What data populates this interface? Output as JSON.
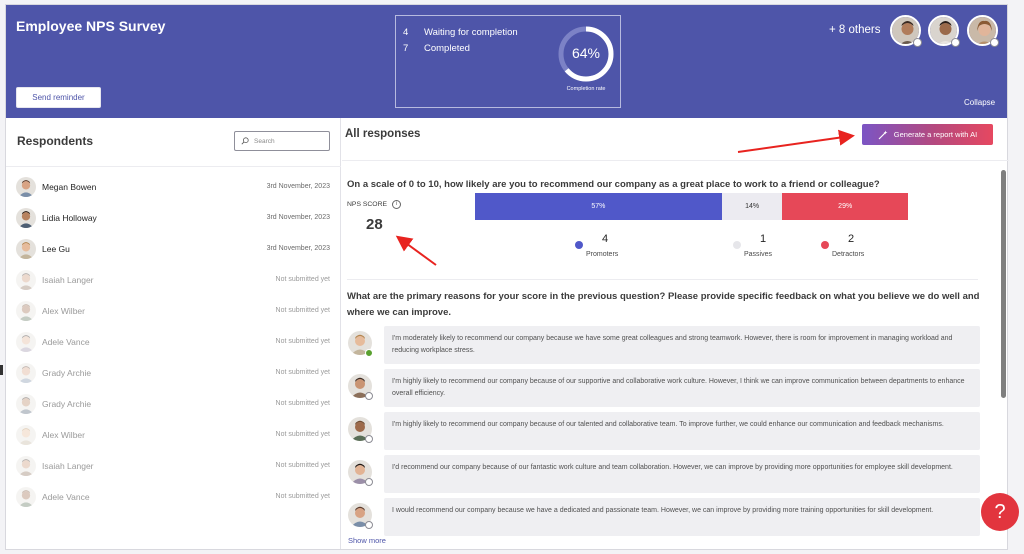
{
  "header": {
    "survey_title": "Employee NPS Survey",
    "send_reminder_label": "Send reminder",
    "stats": [
      {
        "count": "4",
        "label": "Waiting for completion"
      },
      {
        "count": "7",
        "label": "Completed"
      }
    ],
    "completion_rate": "64%",
    "completion_rate_value": 0.64,
    "completion_caption": "Completion rate",
    "others_label": "+ 8 others",
    "collapse_label": "Collapse",
    "header_avatars": [
      "avatar-man-1",
      "avatar-man-2",
      "avatar-woman-1"
    ]
  },
  "respondents": {
    "title": "Respondents",
    "search_placeholder": "Search",
    "rows": [
      {
        "name": "Megan Bowen",
        "date": "3rd November, 2023",
        "submitted": true
      },
      {
        "name": "Lidia Holloway",
        "date": "3rd November, 2023",
        "submitted": true
      },
      {
        "name": "Lee Gu",
        "date": "3rd November, 2023",
        "submitted": true
      },
      {
        "name": "Isaiah Langer",
        "date": "Not submitted yet",
        "submitted": false
      },
      {
        "name": "Alex Wilber",
        "date": "Not submitted yet",
        "submitted": false
      },
      {
        "name": "Adele Vance",
        "date": "Not submitted yet",
        "submitted": false
      },
      {
        "name": "Grady Archie",
        "date": "Not submitted yet",
        "submitted": false
      },
      {
        "name": "Grady Archie",
        "date": "Not submitted yet",
        "submitted": false
      },
      {
        "name": "Alex Wilber",
        "date": "Not submitted yet",
        "submitted": false
      },
      {
        "name": "Isaiah Langer",
        "date": "Not submitted yet",
        "submitted": false
      },
      {
        "name": "Adele Vance",
        "date": "Not submitted yet",
        "submitted": false
      }
    ]
  },
  "main": {
    "all_responses_title": "All responses",
    "generate_button_label": "Generate a report with AI",
    "question1": "On a scale of 0 to 10, how likely are you to recommend our company as a great place to work to a friend or colleague?",
    "nps_score_label": "NPS SCORE",
    "nps_score_value": "28",
    "nps_breakdown": [
      {
        "label": "57%",
        "share": 0.57,
        "color": "#5058c9",
        "text_color": "#ffffff"
      },
      {
        "label": "14%",
        "share": 0.14,
        "color": "#ecebf1",
        "text_color": "#333333"
      },
      {
        "label": "29%",
        "share": 0.29,
        "color": "#e64858",
        "text_color": "#ffffff"
      }
    ],
    "legend": [
      {
        "count": "4",
        "label": "Promoters",
        "color": "#5058c9"
      },
      {
        "count": "1",
        "label": "Passives",
        "color": "#e6e6ea"
      },
      {
        "count": "2",
        "label": "Detractors",
        "color": "#e64858"
      }
    ],
    "question2": "What are the primary reasons for your score in the previous question? Please provide specific feedback on what you believe we do well and where we can improve.",
    "comments": [
      {
        "text": "I'm moderately likely to recommend our company because we have some great colleagues and strong teamwork. However, there is room for improvement in managing workload and reducing workplace stress.",
        "verified": true
      },
      {
        "text": "I'm highly likely to recommend our company because of our supportive and collaborative work culture. However, I think we can improve communication between departments to enhance overall efficiency.",
        "verified": false
      },
      {
        "text": "I'm highly likely to recommend our company because of our talented and collaborative team. To improve further, we could enhance our communication and feedback mechanisms.",
        "verified": false
      },
      {
        "text": "I'd recommend our company because of our fantastic work culture and team collaboration. However, we can improve by providing more opportunities for employee skill development.",
        "verified": false
      },
      {
        "text": "I would recommend our company because we have a dedicated and passionate team. However, we can improve by providing more training opportunities for skill development.",
        "verified": false
      }
    ],
    "show_more_label": "Show more",
    "help_label": "?"
  }
}
